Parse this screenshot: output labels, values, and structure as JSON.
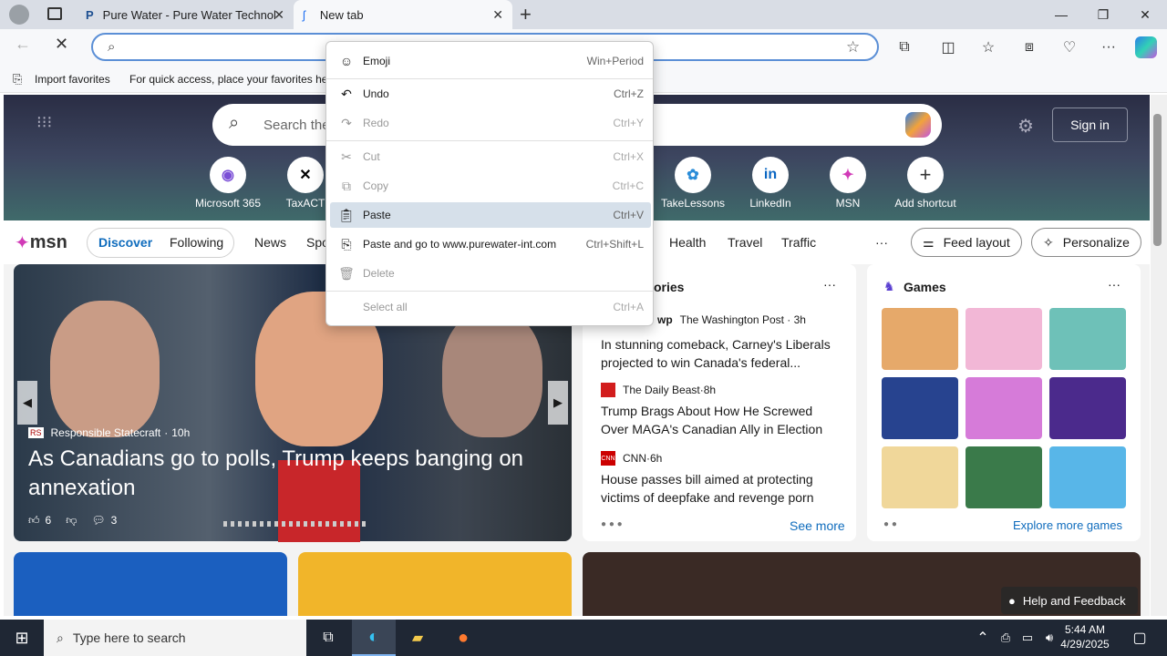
{
  "tabs": [
    {
      "label": "Pure Water - Pure Water Technol"
    },
    {
      "label": "New tab"
    }
  ],
  "favorites": {
    "import": "Import favorites",
    "hint": "For quick access, place your favorites her"
  },
  "search": {
    "placeholder": "Search the"
  },
  "signin": "Sign in",
  "shortcuts": [
    {
      "label": "Microsoft 365"
    },
    {
      "label": "TaxACT"
    },
    {
      "label": "TakeLessons"
    },
    {
      "label": "LinkedIn"
    },
    {
      "label": "MSN"
    },
    {
      "label": "Add shortcut"
    }
  ],
  "msn": {
    "logo": "msn",
    "discover": "Discover",
    "following": "Following",
    "news": "News",
    "sports": "Spo",
    "health": "Health",
    "travel": "Travel",
    "traffic": "Traffic",
    "feed_layout": "Feed layout",
    "personalize": "Personalize"
  },
  "hero_story": {
    "source": "Responsible Statecraft",
    "age": "10h",
    "headline": "As Canadians go to polls, Trump keeps banging on annexation",
    "likes": "6",
    "comments": "3"
  },
  "stories": {
    "title": "ories",
    "items": [
      {
        "source": "The Washington Post",
        "age": "3h",
        "headline": "In stunning comeback, Carney's Liberals projected to win Canada's federal..."
      },
      {
        "source": "The Daily Beast",
        "age": "8h",
        "headline": "Trump Brags About How He Screwed Over MAGA's Canadian Ally in Election"
      },
      {
        "source": "CNN",
        "age": "6h",
        "headline": "House passes bill aimed at protecting victims of deepfake and revenge porn"
      }
    ],
    "see_more": "See more"
  },
  "games": {
    "title": "Games",
    "explore": "Explore more games"
  },
  "help": "Help and Feedback",
  "context_menu": [
    {
      "label": "Emoji",
      "shortcut": "Win+Period"
    },
    {
      "label": "Undo",
      "shortcut": "Ctrl+Z"
    },
    {
      "label": "Redo",
      "shortcut": "Ctrl+Y"
    },
    {
      "label": "Cut",
      "shortcut": "Ctrl+X"
    },
    {
      "label": "Copy",
      "shortcut": "Ctrl+C"
    },
    {
      "label": "Paste",
      "shortcut": "Ctrl+V"
    },
    {
      "label": "Paste and go to www.purewater-int.com",
      "shortcut": "Ctrl+Shift+L"
    },
    {
      "label": "Delete",
      "shortcut": ""
    },
    {
      "label": "Select all",
      "shortcut": "Ctrl+A"
    }
  ],
  "taskbar": {
    "search_placeholder": "Type here to search",
    "time": "5:44 AM",
    "date": "4/29/2025"
  },
  "colors": {
    "accent": "#0f6cbd",
    "taskbar": "#1f2734"
  }
}
